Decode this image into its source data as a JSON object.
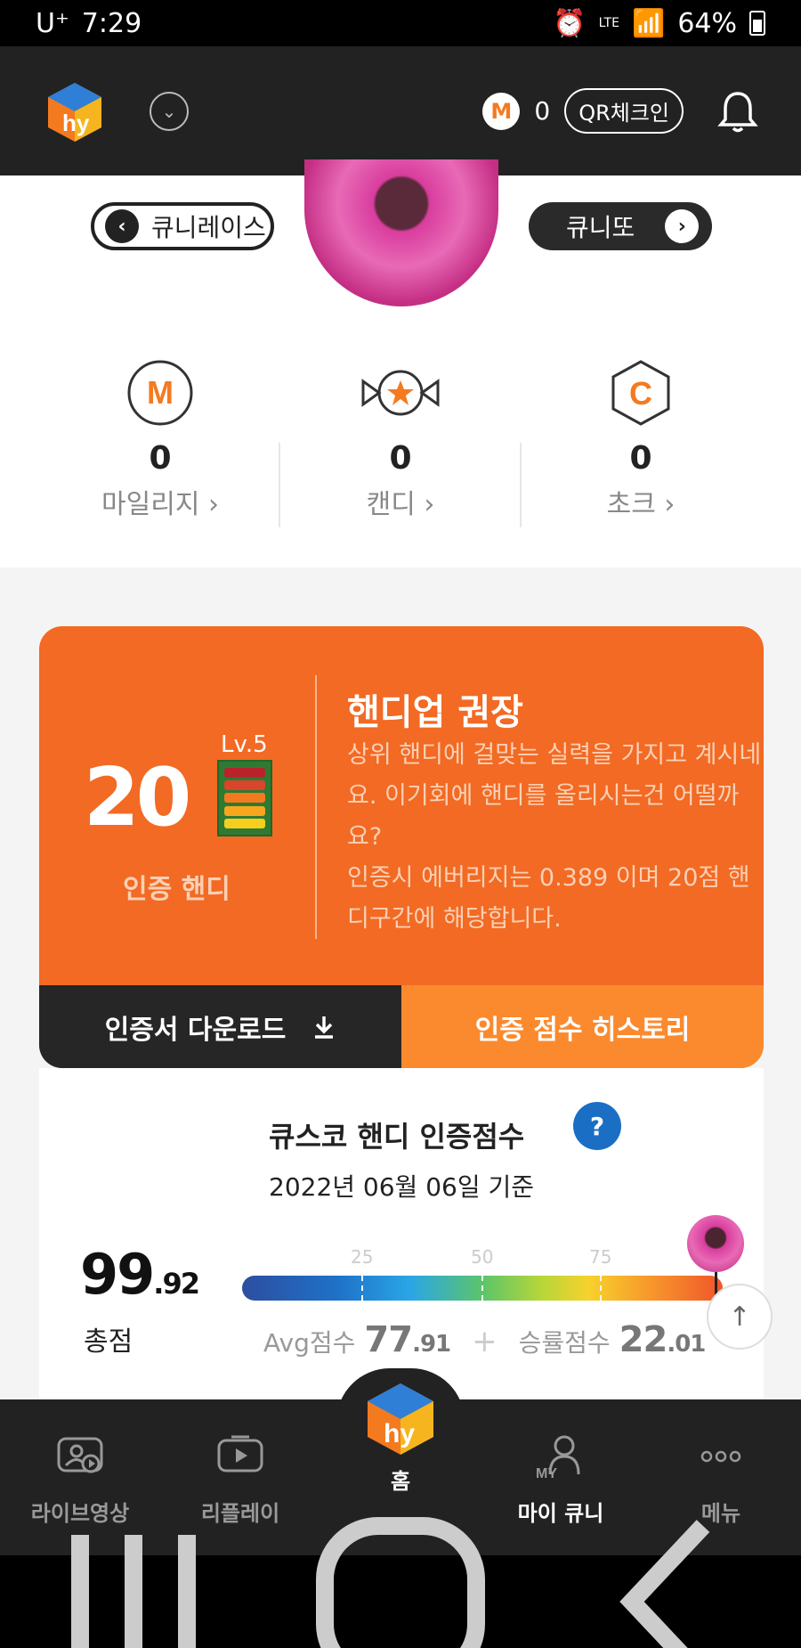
{
  "status_bar": {
    "carrier": "U⁺",
    "time": "7:29",
    "network": "LTE",
    "battery": "64%"
  },
  "header": {
    "mileage_icon": "M",
    "mileage_value": "0",
    "qr_checkin": "QR체크인"
  },
  "profile": {
    "prev_label": "큐니레이스",
    "next_label": "큐니또",
    "stats": [
      {
        "icon": "mileage-icon",
        "value": "0",
        "label": "마일리지 ›"
      },
      {
        "icon": "candy-icon",
        "value": "0",
        "label": "캔디 ›"
      },
      {
        "icon": "chalk-icon",
        "value": "0",
        "label": "초크 ›"
      }
    ]
  },
  "handicap_card": {
    "handicap": "20",
    "level": "Lv.5",
    "label": "인증 핸디",
    "title": "핸디업 권장",
    "description_1": "상위 핸디에 걸맞는 실력을 가지고 계시네요. 이기회에 핸디를 올리시는건 어떨까요?",
    "description_2": "인증시 에버리지는 0.389 이며 20점 핸디구간에 해당합니다.",
    "download_label": "인증서 다운로드",
    "history_label": "인증 점수 히스토리",
    "colors": {
      "card": "#f26a23",
      "history_button": "#fb8a2e"
    }
  },
  "score": {
    "title": "큐스코 핸디 인증점수",
    "help": "?",
    "date": "2022년 06월 06일 기준",
    "total_int": "99",
    "total_dec": ".92",
    "total_label": "총점",
    "ticks": [
      "25",
      "50",
      "75"
    ],
    "avg_label": "Avg점수",
    "avg_int": "77",
    "avg_dec": ".91",
    "plus": "+",
    "win_label": "승률점수",
    "win_int": "22",
    "win_dec": ".01"
  },
  "bottom_nav": [
    {
      "label": "라이브영상",
      "icon": "live-video-icon"
    },
    {
      "label": "리플레이",
      "icon": "replay-icon"
    },
    {
      "label": "홈",
      "icon": "home-logo-icon"
    },
    {
      "label": "마이 큐니",
      "icon": "my-user-icon"
    },
    {
      "label": "메뉴",
      "icon": "more-dots-icon"
    }
  ]
}
